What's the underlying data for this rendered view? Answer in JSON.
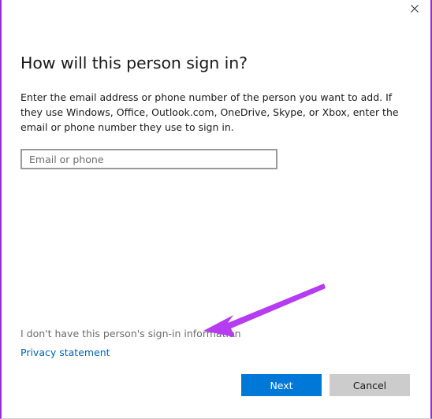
{
  "dialog": {
    "title": "How will this person sign in?",
    "description": "Enter the email address or phone number of the person you want to add. If they use Windows, Office, Outlook.com, OneDrive, Skype, or Xbox, enter the email or phone number they use to sign in.",
    "email_input": {
      "placeholder": "Email or phone",
      "value": ""
    },
    "no_info_link": "I don't have this person's sign-in information",
    "privacy_link": "Privacy statement",
    "next_button": "Next",
    "cancel_button": "Cancel"
  },
  "icons": {
    "close": "close-icon",
    "annotation": "arrow-annotation-icon"
  },
  "colors": {
    "accent": "#0078d7",
    "link": "#0063b1",
    "annotation_arrow": "#b53cf0",
    "window_border": "#9a2bd6",
    "cancel_bg": "#cccccc"
  }
}
